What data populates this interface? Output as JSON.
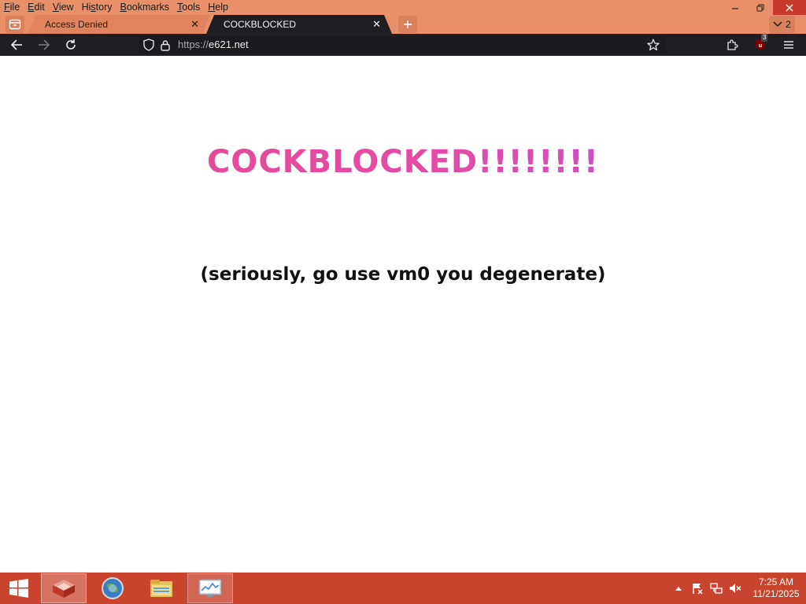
{
  "menu": {
    "items": [
      {
        "label": "File",
        "underline": "F",
        "rest": "ile"
      },
      {
        "label": "Edit",
        "underline": "E",
        "rest": "dit"
      },
      {
        "label": "View",
        "underline": "V",
        "rest": "iew"
      },
      {
        "label": "History",
        "pre": "Hi",
        "underline": "s",
        "rest": "tory"
      },
      {
        "label": "Bookmarks",
        "underline": "B",
        "rest": "ookmarks"
      },
      {
        "label": "Tools",
        "underline": "T",
        "rest": "ools"
      },
      {
        "label": "Help",
        "underline": "H",
        "rest": "elp"
      }
    ]
  },
  "tabs": [
    {
      "label": "Access Denied",
      "close": "✕"
    },
    {
      "label": "COCKBLOCKED",
      "close": "✕"
    }
  ],
  "tab_count": "2",
  "address": {
    "scheme": "https://",
    "host": "e621.net"
  },
  "extension_badge": "3",
  "page": {
    "headline": "COCKBLOCKED!!!!!!!!",
    "subtitle": "(seriously, go use vm0 you degenerate)"
  },
  "clock": {
    "time": "7:25 AM",
    "date": "11/21/2025"
  },
  "colors": {
    "titlebar": "#e9906a",
    "toolbar": "#1e1e23",
    "taskbar": "#c8442e",
    "headline_start": "#c3566d",
    "headline_mid": "#e64a98",
    "headline_end": "#a952cf"
  }
}
